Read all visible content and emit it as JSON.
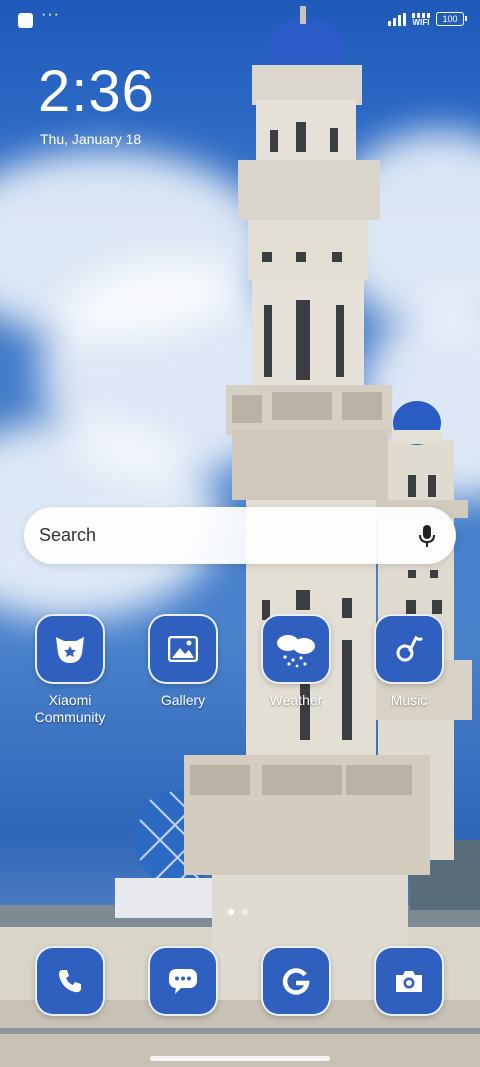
{
  "status_bar": {
    "battery": "100",
    "wifi": "WIFI"
  },
  "lockscreen": {
    "time": "2:36",
    "date": "Thu, January 18"
  },
  "search": {
    "placeholder": "Search"
  },
  "apps": [
    {
      "label": "Xiaomi Community",
      "icon": "xiaomi-community-icon"
    },
    {
      "label": "Gallery",
      "icon": "gallery-icon"
    },
    {
      "label": "Weather",
      "icon": "weather-icon"
    },
    {
      "label": "Music",
      "icon": "music-icon"
    }
  ],
  "dock": [
    {
      "icon": "phone-icon"
    },
    {
      "icon": "messages-icon"
    },
    {
      "icon": "google-icon"
    },
    {
      "icon": "camera-icon"
    }
  ],
  "page_indicator": {
    "pages": 2,
    "current": 1
  },
  "colors": {
    "icon_bg": "#2f5fbf",
    "sky": "#2a68c4"
  }
}
